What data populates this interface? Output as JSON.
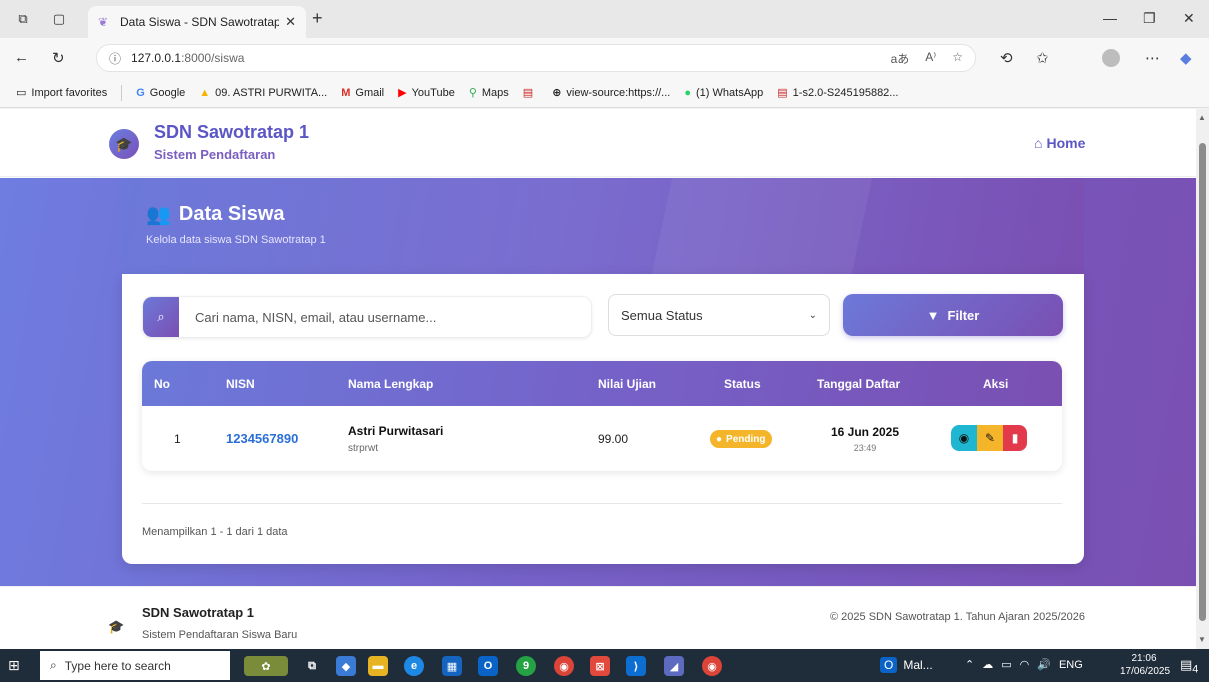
{
  "browser": {
    "tab_title": "Data Siswa - SDN Sawotratap 1",
    "tab_close": "✕",
    "new_tab": "+",
    "url_host": "127.0.0.1",
    "url_path": ":8000/siswa",
    "bookmarks": [
      {
        "icon": "folder-icon",
        "label": "Import favorites"
      },
      {
        "icon": "google-icon",
        "label": "Google"
      },
      {
        "icon": "drive-icon",
        "label": "09. ASTRI PURWITA..."
      },
      {
        "icon": "gmail-icon",
        "label": "Gmail"
      },
      {
        "icon": "youtube-icon",
        "label": "YouTube"
      },
      {
        "icon": "maps-icon",
        "label": "Maps"
      },
      {
        "icon": "pdf-icon",
        "label": ""
      },
      {
        "icon": "globe-icon",
        "label": "view-source:https://..."
      },
      {
        "icon": "whatsapp-icon",
        "label": "(1) WhatsApp"
      },
      {
        "icon": "pdf-icon",
        "label": "1-s2.0-S245195882..."
      }
    ]
  },
  "site": {
    "brand_name": "SDN Sawotratap 1",
    "brand_sub": "Sistem Pendaftaran",
    "home_label": "Home"
  },
  "page": {
    "title": "Data Siswa",
    "subtitle": "Kelola data siswa SDN Sawotratap 1",
    "search_placeholder": "Cari nama, NISN, email, atau username...",
    "status_selected": "Semua Status",
    "filter_label": "Filter",
    "pagination_info": "Menampilkan 1 - 1 dari 1 data"
  },
  "table": {
    "headers": [
      "No",
      "NISN",
      "Nama Lengkap",
      "Nilai Ujian",
      "Status",
      "Tanggal Daftar",
      "Aksi"
    ],
    "rows": [
      {
        "no": "1",
        "nisn": "1234567890",
        "nama": "Astri Purwitasari",
        "username": "strprwt",
        "nilai": "99.00",
        "status": "Pending",
        "tanggal": "16 Jun 2025",
        "jam": "23:49"
      }
    ]
  },
  "footer": {
    "name": "SDN Sawotratap 1",
    "sub": "Sistem Pendaftaran Siswa Baru",
    "copyright": "© 2025 SDN Sawotratap 1. Tahun Ajaran 2025/2026"
  },
  "taskbar": {
    "search_placeholder": "Type here to search",
    "mail_label": "Mal...",
    "lang": "ENG",
    "time": "21:06",
    "date": "17/06/2025",
    "badge_count": "9",
    "notif_count": "4"
  },
  "colors": {
    "accent": "#6c79d9",
    "accent_dark": "#7a4fb2",
    "link": "#2b6fd6",
    "pending": "#f5b52a",
    "view": "#1fb6d1",
    "delete": "#e23a4a"
  }
}
